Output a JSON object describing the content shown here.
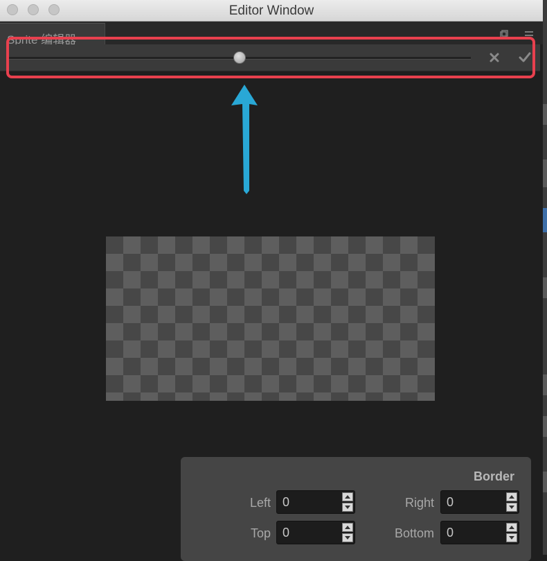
{
  "window": {
    "title": "Editor Window"
  },
  "tab": {
    "label": "Sprite 编辑器"
  },
  "toolbar": {
    "slider_value": 0.5,
    "cancel_icon": "close-icon",
    "apply_icon": "check-icon"
  },
  "colors": {
    "highlight": "#e8404e",
    "arrow": "#29a8d6"
  },
  "border_panel": {
    "title": "Border",
    "left": {
      "label": "Left",
      "value": "0"
    },
    "right": {
      "label": "Right",
      "value": "0"
    },
    "top": {
      "label": "Top",
      "value": "0"
    },
    "bottom": {
      "label": "Bottom",
      "value": "0"
    }
  }
}
